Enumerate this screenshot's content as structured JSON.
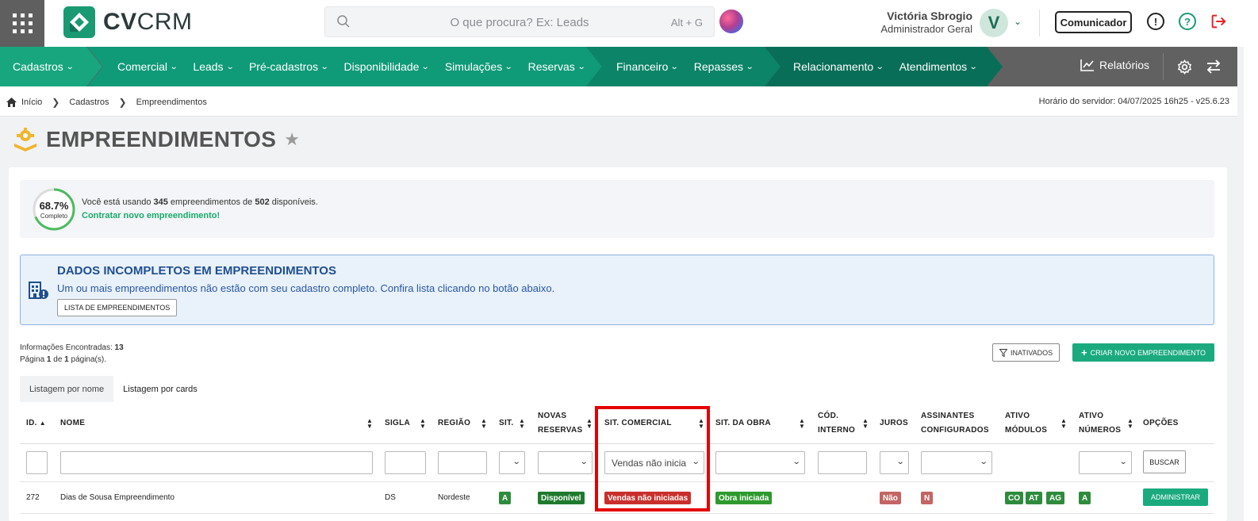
{
  "app": {
    "logo_text_bold": "CV",
    "logo_text_light": "CRM",
    "search_placeholder": "O que procura? Ex: Leads",
    "search_shortcut": "Alt + G",
    "user_name": "Victória Sbrogio",
    "user_role": "Administrador Geral",
    "avatar_initial": "V",
    "comunicador_label": "Comunicador"
  },
  "nav": {
    "group1": [
      "Cadastros"
    ],
    "group2": [
      "Comercial",
      "Leads",
      "Pré-cadastros",
      "Disponibilidade",
      "Simulações",
      "Reservas"
    ],
    "group3": [
      "Financeiro",
      "Repasses"
    ],
    "group4": [
      "Relacionamento",
      "Atendimentos"
    ],
    "reports_label": "Relatórios",
    "colors": {
      "group1": "#17a67e",
      "group2": "#0f9a78",
      "group3": "#0b8468",
      "group4": "#096e58"
    }
  },
  "breadcrumb": [
    "Início",
    "Cadastros",
    "Empreendimentos"
  ],
  "server_time": "Horário do servidor: 04/07/2025 16h25 - v25.6.23",
  "page_title": "EMPREENDIMENTOS",
  "usage": {
    "percent_label": "68.7%",
    "percent_value": 68.7,
    "complete_label": "Completo",
    "text_prefix": "Você está usando ",
    "used": "345",
    "text_mid": " empreendimentos de ",
    "total": "502",
    "text_suffix": " disponíveis.",
    "link": "Contratar novo empreendimento!"
  },
  "alert": {
    "title": "DADOS INCOMPLETOS EM EMPREENDIMENTOS",
    "message": "Um ou mais empreendimentos não estão com seu cadastro completo. Confira lista clicando no botão abaixo.",
    "button": "LISTA DE EMPREENDIMENTOS"
  },
  "results": {
    "found_label": "Informações Encontradas: ",
    "found": "13",
    "page_label": "Página ",
    "page": "1",
    "of_label": " de ",
    "pages": "1",
    "pages_suffix": " página(s)."
  },
  "buttons": {
    "inactive": "INATIVADOS",
    "create": "CRIAR NOVO EMPREENDIMENTO",
    "search": "BUSCAR",
    "manage": "ADMINISTRAR"
  },
  "tabs": [
    "Listagem por nome",
    "Listagem por cards"
  ],
  "columns": {
    "id": "ID.",
    "nome": "NOME",
    "sigla": "SIGLA",
    "regiao": "REGIÃO",
    "sit": "SIT.",
    "novas1": "NOVAS",
    "novas2": "RESERVAS",
    "sit_comercial": "SIT. COMERCIAL",
    "sit_obra": "SIT. DA OBRA",
    "cod1": "CÓD.",
    "cod2": "INTERNO",
    "juros": "JUROS",
    "assin1": "ASSINANTES",
    "assin2": "CONFIGURADOS",
    "mod1": "ATIVO",
    "mod2": "MÓDULOS",
    "num1": "ATIVO",
    "num2": "NÚMEROS",
    "opcoes": "OPÇÕES"
  },
  "filters": {
    "sit_comercial_value": "Vendas não inicia"
  },
  "row": {
    "id": "272",
    "nome": "Dias de Sousa Empreendimento",
    "sigla": "DS",
    "regiao": "Nordeste",
    "sit": "A",
    "novas_reservas": "Disponível",
    "sit_comercial": "Vendas não iniciadas",
    "sit_obra": "Obra iniciada",
    "juros": "Não",
    "assinantes": "N",
    "modulos": [
      "CO",
      "AT",
      "AG"
    ],
    "numeros": "A"
  }
}
